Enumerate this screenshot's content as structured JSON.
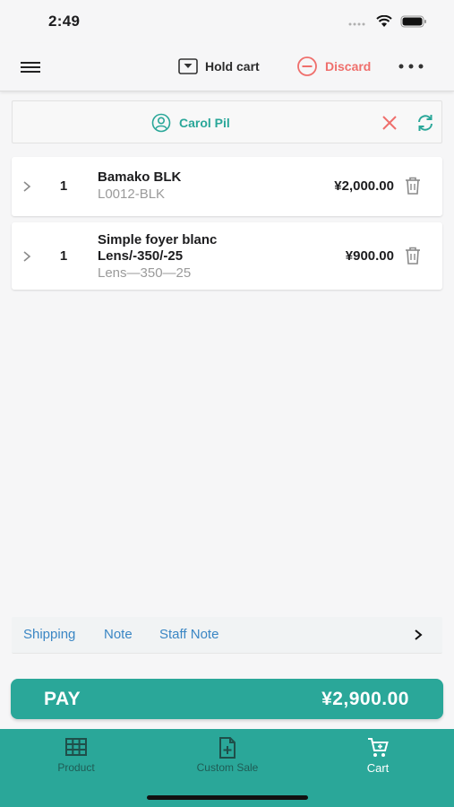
{
  "status_bar": {
    "time": "2:49"
  },
  "header": {
    "hold_label": "Hold cart",
    "discard_label": "Discard"
  },
  "customer": {
    "name": "Carol Pil"
  },
  "cart": {
    "items": [
      {
        "qty": "1",
        "name": "Bamako BLK",
        "sku": "L0012-BLK",
        "price": "¥2,000.00"
      },
      {
        "qty": "1",
        "name_line1": "Simple foyer blanc",
        "name_line2": "Lens/-350/-25",
        "sku": "Lens—350—25",
        "price": "¥900.00"
      }
    ]
  },
  "notes": {
    "shipping": "Shipping",
    "note": "Note",
    "staff_note": "Staff Note"
  },
  "pay": {
    "label": "PAY",
    "amount": "¥2,900.00"
  },
  "tabs": [
    {
      "label": "Product",
      "icon": "grid-icon"
    },
    {
      "label": "Custom Sale",
      "icon": "add-document-icon"
    },
    {
      "label": "Cart",
      "icon": "cart-icon"
    }
  ],
  "colors": {
    "brand": "#2aa799",
    "discard": "#ef6f6c",
    "link": "#3a86c4",
    "background": "#f6f6f7"
  }
}
